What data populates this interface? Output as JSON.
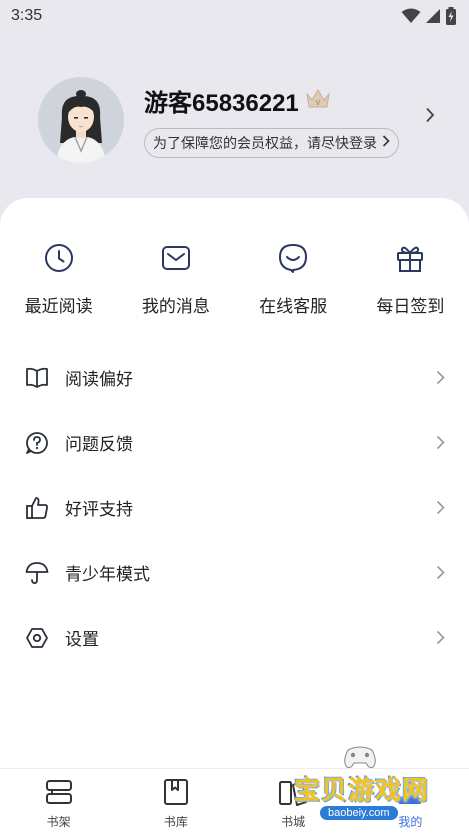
{
  "status_bar": {
    "time": "3:35"
  },
  "profile": {
    "username": "游客65836221",
    "login_prompt": "为了保障您的会员权益，请尽快登录",
    "crown_badge": "V"
  },
  "quick_actions": [
    {
      "label": "最近阅读",
      "icon": "clock-icon"
    },
    {
      "label": "我的消息",
      "icon": "envelope-icon"
    },
    {
      "label": "在线客服",
      "icon": "chat-bubble-icon"
    },
    {
      "label": "每日签到",
      "icon": "gift-icon"
    }
  ],
  "menu": [
    {
      "label": "阅读偏好",
      "icon": "book-icon"
    },
    {
      "label": "问题反馈",
      "icon": "question-icon"
    },
    {
      "label": "好评支持",
      "icon": "thumbs-up-icon"
    },
    {
      "label": "青少年模式",
      "icon": "umbrella-icon"
    },
    {
      "label": "设置",
      "icon": "settings-hexagon-icon"
    }
  ],
  "tabbar": [
    {
      "label": "书架",
      "icon": "bookshelf-icon",
      "active": false
    },
    {
      "label": "书库",
      "icon": "library-icon",
      "active": false
    },
    {
      "label": "书城",
      "icon": "bookstore-icon",
      "active": false
    },
    {
      "label": "我的",
      "icon": "profile-icon",
      "active": true
    }
  ],
  "watermark": {
    "title": "宝贝游戏网",
    "url": "baobeiy.com"
  },
  "colors": {
    "accent": "#3a6fe0",
    "background": "#e8e8ee",
    "sheet": "#ffffff"
  }
}
